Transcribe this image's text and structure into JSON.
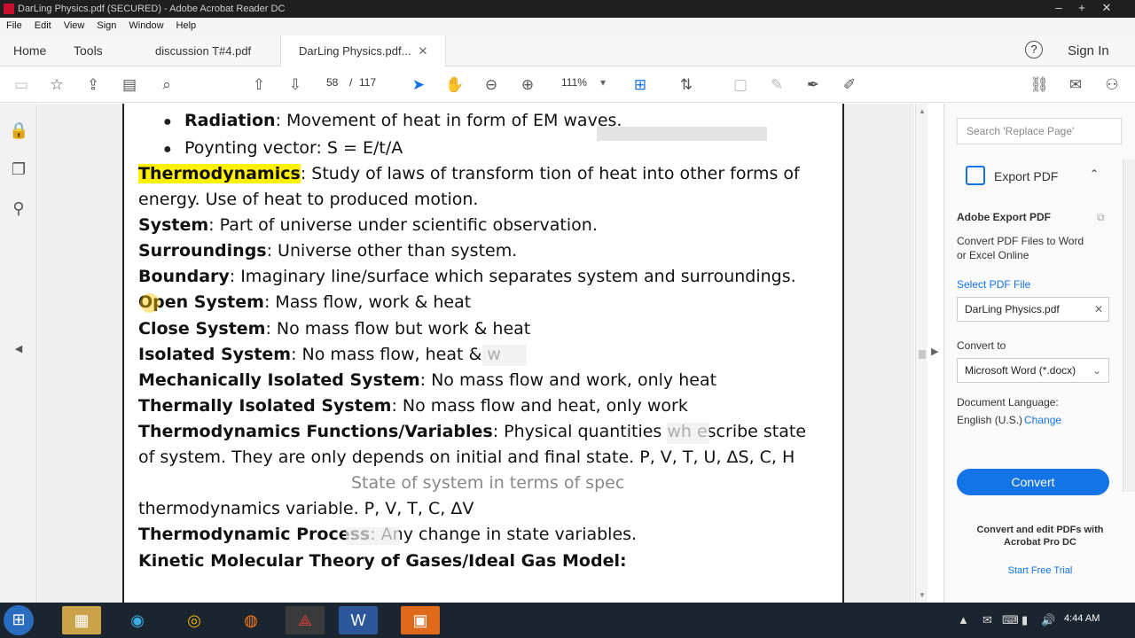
{
  "window": {
    "title": "DarLing Physics.pdf (SECURED) - Adobe Acrobat Reader DC",
    "min": "–",
    "max": "+",
    "close": "✕"
  },
  "menu": [
    "File",
    "Edit",
    "View",
    "Sign",
    "Window",
    "Help"
  ],
  "tabs": {
    "home": "Home",
    "tools": "Tools",
    "doc1": "discussion T#4.pdf",
    "doc2": "DarLing Physics.pdf...",
    "close": "✕",
    "help": "?",
    "signin": "Sign In"
  },
  "toolbar": {
    "page_current": "58",
    "page_sep": "/",
    "page_total": "117",
    "zoom": "111%"
  },
  "document": {
    "bullet1_bold": "Radiation",
    "bullet1_rest": ": Movement of heat in form of EM waves.",
    "bullet2": "Poynting vector: S = E/t/A",
    "l1_bold": "Thermodynamics",
    "l1_rest": ": Study of laws of transform  tion of heat into other forms of",
    "l2": "energy. Use of heat to produced motion.",
    "l3_bold": "System",
    "l3_rest": ": Part of universe under scientific observation.",
    "l4_bold": "Surroundings",
    "l4_rest": ": Universe other than system.",
    "l5_bold": "Boundary",
    "l5_rest": ": Imaginary line/surface which separates system and surroundings.",
    "l6_bold": "Open System",
    "l6_rest": ": Mass flow, work & heat",
    "l7_bold": "Close System",
    "l7_rest": ": No mass flow but work & heat",
    "l8_bold": "Isolated System",
    "l8_rest": ": No mass flow, heat & w",
    "l9_bold": "Mechanically Isolated System",
    "l9_rest": ": No mass flow and work, only heat",
    "l10_bold": "Thermally Isolated System",
    "l10_rest": ": No mass flow and heat, only work",
    "l11_bold": "Thermodynamics Functions/Variables",
    "l11_rest": ": Physical quantities wh    escribe state",
    "l12": "of system. They are only depends on initial and final state. P, V, T, U, ΔS, C, H",
    "l13": "State of system in terms of spec",
    "l14": "thermodynamics variable. P, V, T, C, ΔV",
    "l15_bold": "Thermodynamic Process",
    "l15_rest": ": Any change in state variables.",
    "l16_bold": "Kinetic Molecular Theory of Gases/Ideal Gas Model:"
  },
  "right_panel": {
    "search_placeholder": "Search 'Replace Page'",
    "export_title": "Export PDF",
    "adobe_export": "Adobe Export PDF",
    "convert_desc": "Convert PDF Files to Word or Excel Online",
    "select_file": "Select PDF File",
    "file_name": "DarLing Physics.pdf",
    "convert_to": "Convert to",
    "format": "Microsoft Word (*.docx)",
    "doc_lang": "Document Language:",
    "lang": "English (U.S.)",
    "change": "Change",
    "convert_btn": "Convert",
    "promo": "Convert and edit PDFs with Acrobat Pro DC",
    "trial": "Start Free Trial"
  },
  "taskbar": {
    "time": "4:44 AM"
  }
}
